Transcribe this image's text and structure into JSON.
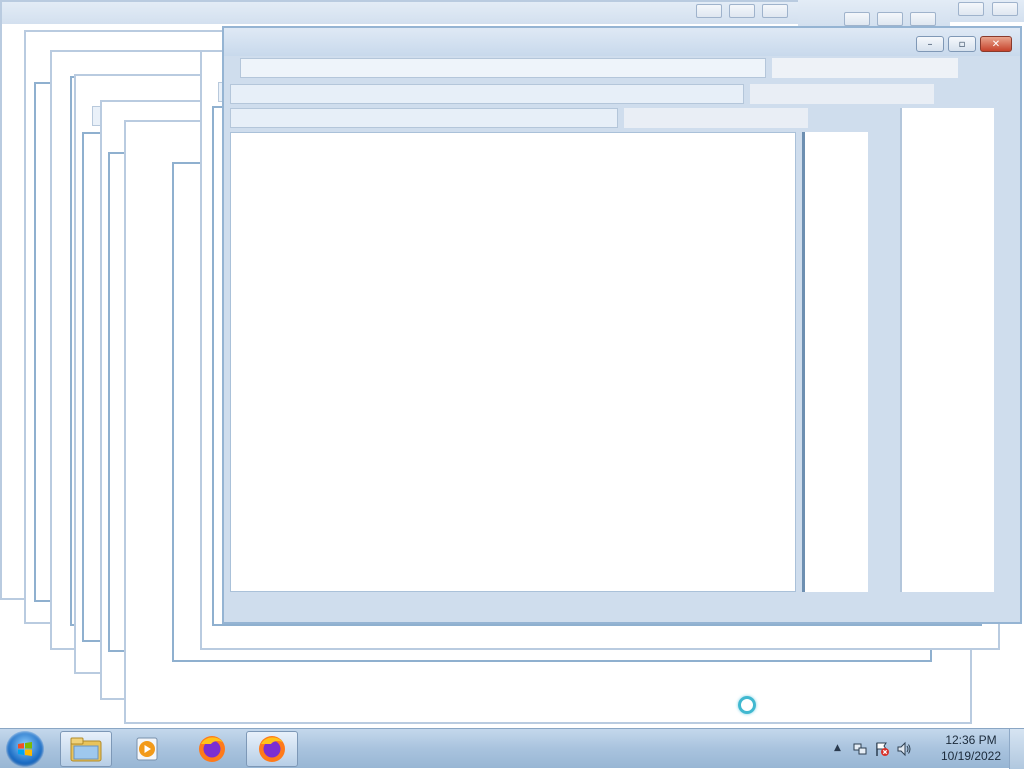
{
  "desktop": {
    "background": "#ffffff"
  },
  "window": {
    "title": "",
    "caption_buttons": {
      "minimize_symbol": "–",
      "maximize_symbol": "▫",
      "close_symbol": "✕"
    },
    "close_color": "#c6422b"
  },
  "taskbar": {
    "start_button": "start-orb",
    "pinned": [
      {
        "name": "Windows Explorer",
        "icon": "folder-icon",
        "active": true
      },
      {
        "name": "Windows Media Player",
        "icon": "media-player-icon",
        "active": false
      },
      {
        "name": "Firefox",
        "icon": "firefox-icon",
        "active": false
      },
      {
        "name": "Firefox",
        "icon": "firefox-icon",
        "active": true
      }
    ],
    "tray": {
      "show_hidden_symbol": "▲",
      "icons": [
        "network-icon",
        "action-center-flag-icon",
        "volume-icon"
      ],
      "time": "12:36 PM",
      "date": "10/19/2022"
    }
  },
  "cursor": {
    "state": "busy",
    "icon": "busy-spinner-icon"
  }
}
